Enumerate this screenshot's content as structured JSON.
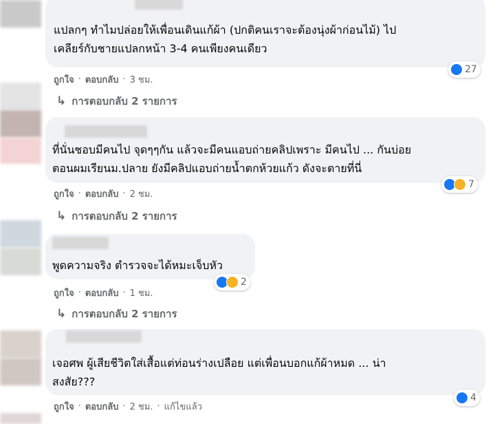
{
  "comments": [
    {
      "text": "แปลกๆ ทำไมปล่อยให้เพื่อนเดินแก้ผ้า (ปกติคนเราจะต้องนุ่งผ้าก่อนไม้) ไป\nเคลียร์กับชายแปลกหน้า 3-4 คนเพียงคนเดียว",
      "like": "ถูกใจ",
      "reply": "ตอบกลับ",
      "time": "3 ชม.",
      "edited": "",
      "reaction_count": "27",
      "reactions": [
        "like-icon"
      ],
      "replies": "การตอบกลับ 2 รายการ"
    },
    {
      "text": "ที่นั่นชอบมีคนไป จุดๆๆกัน แล้วจะมีคนแอบถ่ายคลิปเพราะ มีคนไป ... กันบ่อย\nตอนผมเรียนม.ปลาย ยังมีคลิปแอบถ่ายน้ำตกห้วยแก้ว ดังจะตายที่นี่",
      "like": "ถูกใจ",
      "reply": "ตอบกลับ",
      "time": "2 ชม.",
      "edited": "",
      "reaction_count": "7",
      "reactions": [
        "like-icon",
        "haha-icon"
      ],
      "replies": "การตอบกลับ 2 รายการ"
    },
    {
      "text": "พูดความจริง ตำรวจจะได้หมะเจ็บหัว",
      "like": "ถูกใจ",
      "reply": "ตอบกลับ",
      "time": "1 ชม.",
      "edited": "",
      "reaction_count": "2",
      "reactions": [
        "like-icon",
        "haha-icon"
      ],
      "replies": "การตอบกลับ 2 รายการ"
    },
    {
      "text": "เจอศพ ผู้เสียชีวิตใส่เสื้อแต่ท่อนร่างเปลือย แต่เพื่อนบอกแก้ผ้าหมด ... น่า\nสงสัย???",
      "like": "ถูกใจ",
      "reply": "ตอบกลับ",
      "time": "2 ชม.",
      "edited": "แก้ไขแล้ว",
      "reaction_count": "4",
      "reactions": [
        "like-icon"
      ],
      "replies": ""
    }
  ],
  "separator": "·",
  "colors": {
    "bubble": "#f0f2f5",
    "meta": "#65676b",
    "like": "#1877f2",
    "haha": "#f7b125"
  }
}
